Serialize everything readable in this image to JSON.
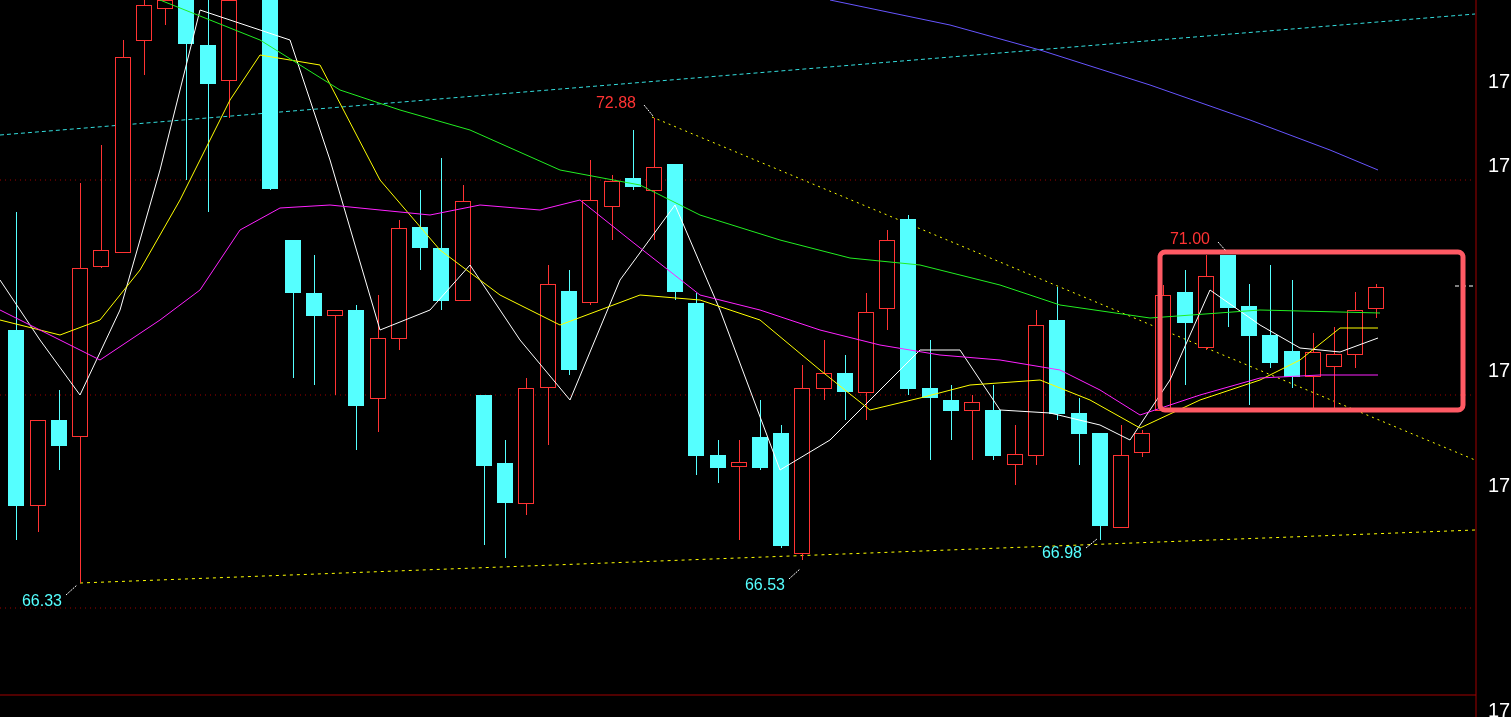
{
  "chart": {
    "price_labels": [
      {
        "text": "72.88",
        "kind": "high"
      },
      {
        "text": "71.00",
        "kind": "high"
      },
      {
        "text": "66.33",
        "kind": "low"
      },
      {
        "text": "66.53",
        "kind": "low"
      },
      {
        "text": "66.98",
        "kind": "low"
      }
    ],
    "axis_labels": [
      "17",
      "17",
      "17",
      "17",
      "17"
    ],
    "highlight_box": true
  }
}
